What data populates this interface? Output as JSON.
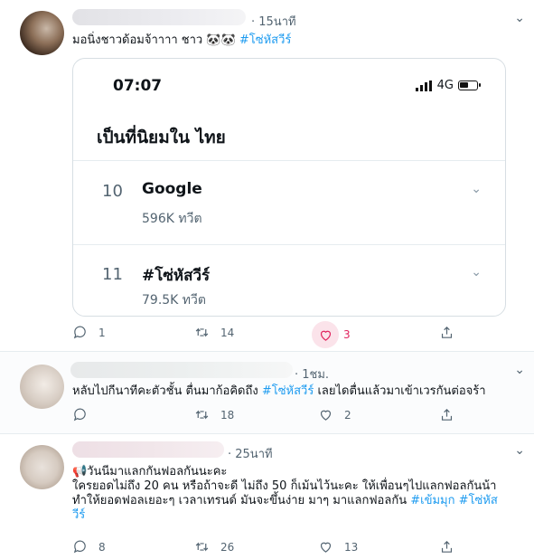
{
  "tweets": [
    {
      "time": "· 15นาที",
      "text": "มอนิ่งชาวด้อมจ้าาาา ชาว 🐼🐼 ",
      "hashtag": "#โซ่หัสวีร์",
      "actions": {
        "reply": "1",
        "retweet": "14",
        "like": "3",
        "share": ""
      }
    },
    {
      "time": "· 1ชม.",
      "text": "หลับไปกีนาทีคะตัวชั้น ตื่นมาก้อคิดถึง ",
      "hashtag": "#โซ่หัสวีร์",
      "text_after": " เลยไดตื่นแล้วมาเข้าเวรกันต่อจร้า",
      "actions": {
        "reply": "",
        "retweet": "18",
        "like": "2",
        "share": ""
      }
    },
    {
      "time": "· 25นาที",
      "line1": "📢วันนีมาแลกกันฟอลกันนะคะ",
      "line2": "ใครยอดไม่ถึง 20 คน หรือถ้าจะดี ไม่ถึง 50 ก็เม้นไว้นะคะ ให้เพื่อนๆไปแลกฟอลกันน้า",
      "line3": "ทำให้ยอดฟอลเยอะๆ เวลาเทรนด์ มันจะขึ้นง่าย มาๆ มาแลกฟอลกัน ",
      "hashtag1": "#เข้มมุก",
      "hashtag2": "#โซ่หัส",
      "hashtag2_cont": "วีร์",
      "actions": {
        "reply": "8",
        "retweet": "26",
        "like": "13",
        "share": ""
      }
    }
  ],
  "card": {
    "time": "07:07",
    "network": "4G",
    "heading": "เป็นที่นิยมใน ไทย",
    "trends": [
      {
        "rank": "10",
        "name": "Google",
        "count": "596K ทวีต"
      },
      {
        "rank": "11",
        "name": "#โซ่หัสวีร์",
        "count": "79.5K ทวีต"
      }
    ]
  },
  "icons": [
    "reply-icon",
    "retweet-icon",
    "like-icon",
    "share-icon",
    "chevron-down-icon",
    "signal-icon",
    "battery-icon"
  ],
  "colors": {
    "link": "#1d9bf0",
    "like": "#e0245e",
    "muted": "#536471"
  }
}
